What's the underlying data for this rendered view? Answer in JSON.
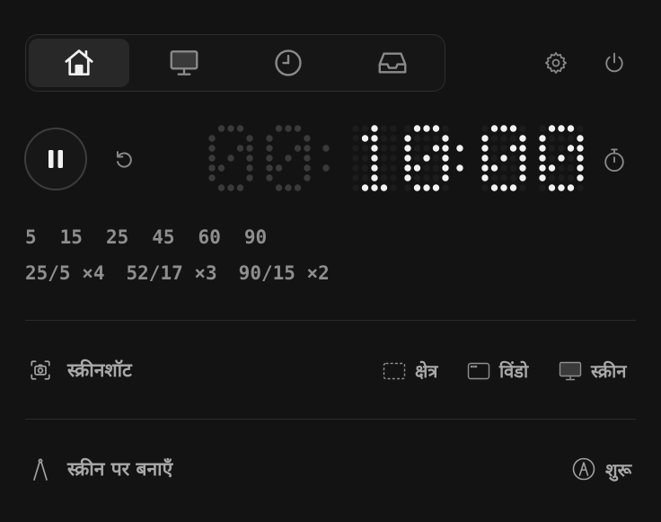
{
  "tabs": [
    {
      "name": "home-icon",
      "active": true
    },
    {
      "name": "monitor-icon",
      "active": false
    },
    {
      "name": "clock-icon",
      "active": false
    },
    {
      "name": "inbox-icon",
      "active": false
    }
  ],
  "header_icons": [
    "gear-icon",
    "power-icon"
  ],
  "timer": {
    "hours": "00",
    "minutes": "10",
    "seconds": "00",
    "state": "running"
  },
  "presets": {
    "minutes": [
      "5",
      "15",
      "25",
      "45",
      "60",
      "90"
    ],
    "intervals": [
      "25/5 ×4",
      "52/17 ×3",
      "90/15 ×2"
    ]
  },
  "screenshot": {
    "label": "स्क्रीनशॉट",
    "options": [
      {
        "icon": "dashed-region-icon",
        "label": "क्षेत्र"
      },
      {
        "icon": "window-icon",
        "label": "विंडो"
      },
      {
        "icon": "monitor-icon",
        "label": "स्क्रीन"
      }
    ]
  },
  "draw": {
    "label": "स्क्रीन पर बनाएँ",
    "start_label": "शुरू"
  },
  "colors": {
    "background": "#131313",
    "dot_on": "#f2f2f2",
    "dot_dim": "#3a3a3a",
    "dot_faint": "#1c1c1c",
    "text": "#a8a8a8"
  }
}
